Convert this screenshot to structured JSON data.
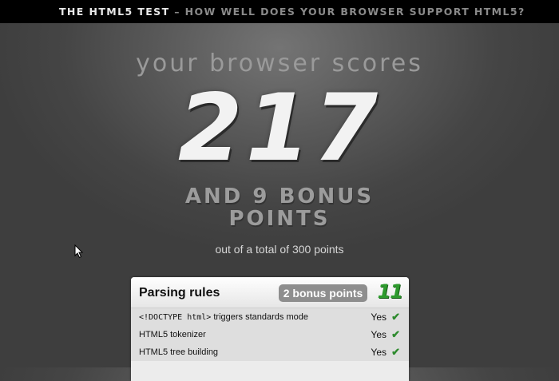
{
  "header": {
    "site_name": "THE HTML5 TEST",
    "tagline": " – HOW WELL DOES YOUR BROWSER SUPPORT HTML5?"
  },
  "summary": {
    "caption": "your browser scores",
    "score": "217",
    "bonus": "and 9 bonus points",
    "total": "out of a total of 300 points"
  },
  "section": {
    "title": "Parsing rules",
    "bonus_badge": "2 bonus points",
    "score": "11",
    "rows": [
      {
        "code": "<!DOCTYPE html>",
        "label": " triggers standards mode",
        "result": "Yes",
        "status": "pass"
      },
      {
        "code": "",
        "label": "HTML5 tokenizer",
        "result": "Yes",
        "status": "pass"
      },
      {
        "code": "",
        "label": "HTML5 tree building",
        "result": "Yes",
        "status": "pass"
      }
    ]
  },
  "icons": {
    "pass": "check-icon",
    "cursor": "mouse-pointer-icon"
  },
  "colors": {
    "pass": "#2e8b2e",
    "score_green": "#2e9b2e",
    "badge_gray": "#8e8e8e"
  }
}
